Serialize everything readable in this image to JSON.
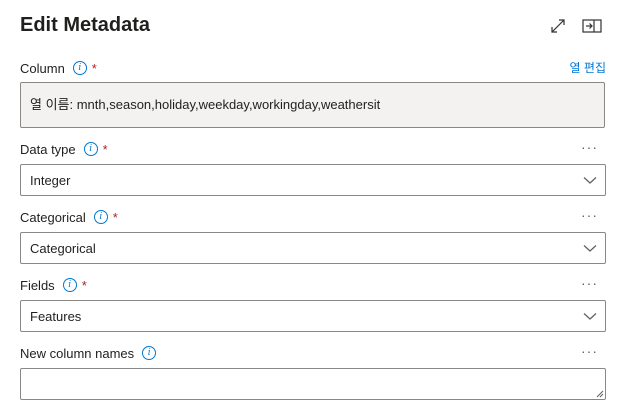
{
  "panel": {
    "title": "Edit Metadata"
  },
  "icons": {
    "expand": "expand-icon",
    "collapse": "collapse-panel-icon",
    "info": "info-icon",
    "more": "more-icon",
    "chevron": "chevron-down-icon"
  },
  "column": {
    "label": "Column",
    "required": "*",
    "edit_link": "열 편집",
    "value": "열 이름: mnth,season,holiday,weekday,workingday,weathersit"
  },
  "data_type": {
    "label": "Data type",
    "required": "*",
    "value": "Integer",
    "more": "···"
  },
  "categorical": {
    "label": "Categorical",
    "required": "*",
    "value": "Categorical",
    "more": "···"
  },
  "fields": {
    "label": "Fields",
    "required": "*",
    "value": "Features",
    "more": "···"
  },
  "new_column_names": {
    "label": "New column names",
    "value": "",
    "more": "···"
  },
  "colors": {
    "accent": "#0078d4",
    "required": "#a4262c",
    "border": "#8a8886",
    "readonly_bg": "#f3f2f1"
  }
}
